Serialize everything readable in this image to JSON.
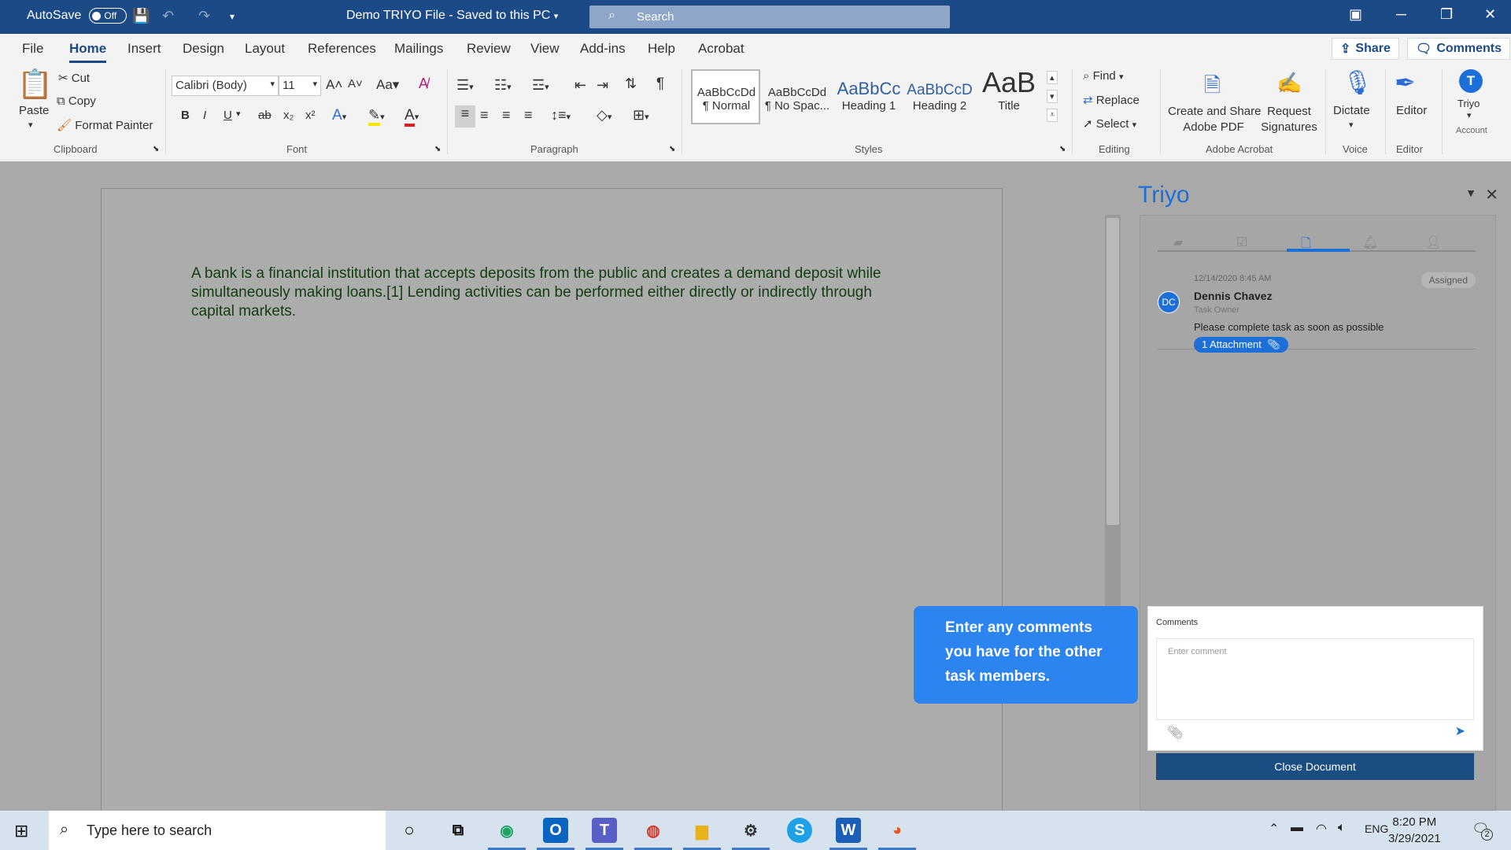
{
  "titlebar": {
    "autosave_label": "AutoSave",
    "autosave_state": "Off",
    "doc_title": "Demo TRIYO File  -  Saved to this PC",
    "search_placeholder": "Search"
  },
  "menu": {
    "tabs": [
      "File",
      "Home",
      "Insert",
      "Design",
      "Layout",
      "References",
      "Mailings",
      "Review",
      "View",
      "Add-ins",
      "Help",
      "Acrobat"
    ],
    "active_tab": "Home",
    "share_label": "Share",
    "comments_label": "Comments"
  },
  "ribbon": {
    "clipboard": {
      "paste": "Paste",
      "cut": "Cut",
      "copy": "Copy",
      "format_painter": "Format Painter",
      "group": "Clipboard"
    },
    "font": {
      "family": "Calibri (Body)",
      "size": "11",
      "group": "Font",
      "buttons": [
        "B",
        "I",
        "U",
        "ab",
        "x₂",
        "x²"
      ]
    },
    "paragraph": {
      "group": "Paragraph"
    },
    "styles": {
      "group": "Styles",
      "items": [
        {
          "preview": "AaBbCcDd",
          "label": "¶ Normal"
        },
        {
          "preview": "AaBbCcDd",
          "label": "¶ No Spac..."
        },
        {
          "preview": "AaBbCc",
          "label": "Heading 1"
        },
        {
          "preview": "AaBbCcD",
          "label": "Heading 2"
        },
        {
          "preview": "AaB",
          "label": "Title"
        }
      ]
    },
    "editing": {
      "find": "Find",
      "replace": "Replace",
      "select": "Select",
      "group": "Editing"
    },
    "acrobat": {
      "create_line1": "Create and Share",
      "create_line2": "Adobe PDF",
      "request_line1": "Request",
      "request_line2": "Signatures",
      "group": "Adobe Acrobat"
    },
    "voice": {
      "dictate": "Dictate",
      "group": "Voice"
    },
    "editor": {
      "label": "Editor",
      "group": "Editor"
    },
    "triyo": {
      "label": "Triyo",
      "group": "Account"
    }
  },
  "document": {
    "body": "A bank is a financial institution that accepts deposits from the public and creates a demand deposit while simultaneously making loans.[1] Lending activities can be performed either directly or indirectly through capital markets."
  },
  "pane": {
    "title": "Triyo",
    "task": {
      "date": "12/14/2020   8:45 AM",
      "status": "Assigned",
      "initials": "DC",
      "name": "Dennis Chavez",
      "role": "Task Owner",
      "message": "Please complete task as soon as possible",
      "attachment": "1 Attachment"
    },
    "comments_label": "Comments",
    "comment_placeholder": "Enter comment",
    "close_button": "Close Document"
  },
  "tooltip": {
    "text": "Enter any comments you have for the other task members."
  },
  "taskbar": {
    "search_placeholder": "Type here to search",
    "lang": "ENG",
    "time": "8:20 PM",
    "date": "3/29/2021",
    "notifications": "2"
  },
  "colors": {
    "title_bar": "#1c4a87",
    "accent": "#1c6fd6",
    "tooltip": "#2b84ef",
    "close_button": "#1a4d82",
    "document_text": "#113d11"
  }
}
